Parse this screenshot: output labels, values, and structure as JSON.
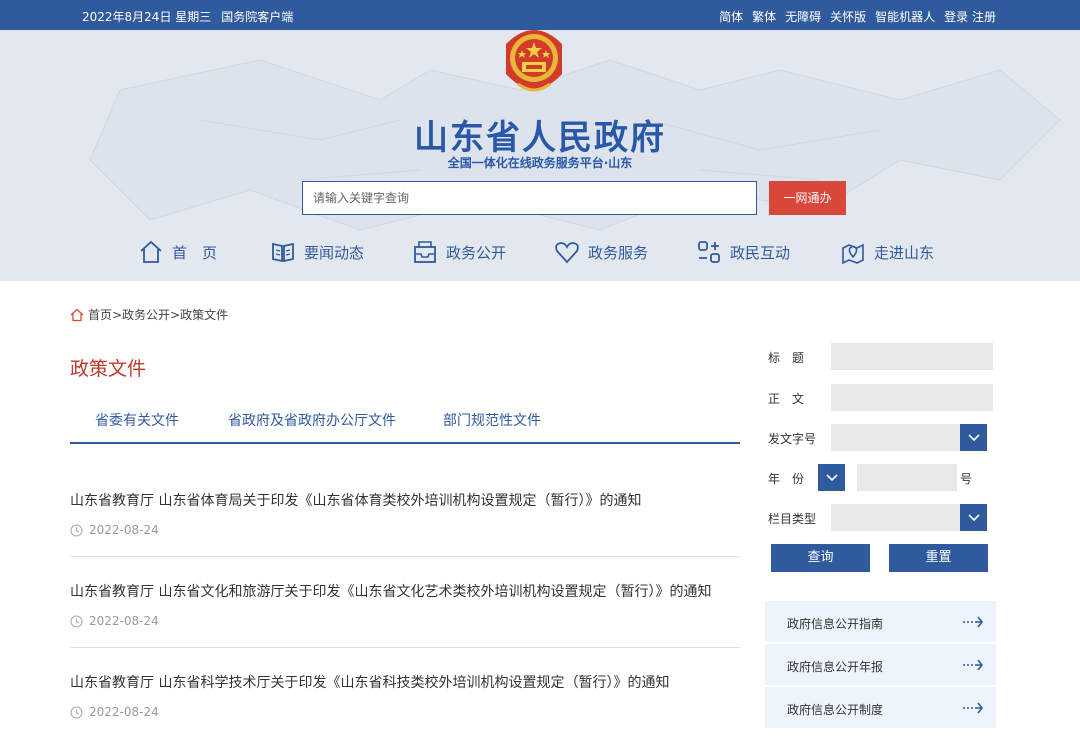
{
  "topbar": {
    "date": "2022年8月24日 星期三",
    "client": "国务院客户端",
    "links": [
      "简体",
      "繁体",
      "无障碍",
      "关怀版",
      "智能机器人",
      "登录 注册"
    ]
  },
  "header": {
    "title": "山东省人民政府",
    "subtitle": "全国一体化在线政务服务平台·山东",
    "search_placeholder": "请输入关键字查询",
    "search_button": "一网通办"
  },
  "nav": {
    "items": [
      {
        "label": "首　页",
        "icon": "home-icon"
      },
      {
        "label": "要闻动态",
        "icon": "book-icon"
      },
      {
        "label": "政务公开",
        "icon": "inbox-icon"
      },
      {
        "label": "政务服务",
        "icon": "heart-icon"
      },
      {
        "label": "政民互动",
        "icon": "interaction-icon"
      },
      {
        "label": "走进山东",
        "icon": "map-pin-icon"
      }
    ]
  },
  "breadcrumb": {
    "text": "首页>政务公开>政策文件"
  },
  "page": {
    "title": "政策文件"
  },
  "tabs": [
    "省委有关文件",
    "省政府及省政府办公厅文件",
    "部门规范性文件"
  ],
  "documents": [
    {
      "title": "山东省教育厅 山东省体育局关于印发《山东省体育类校外培训机构设置规定（暂行）》的通知",
      "date": "2022-08-24"
    },
    {
      "title": "山东省教育厅 山东省文化和旅游厅关于印发《山东省文化艺术类校外培训机构设置规定（暂行）》的通知",
      "date": "2022-08-24"
    },
    {
      "title": "山东省教育厅 山东省科学技术厅关于印发《山东省科技类校外培训机构设置规定（暂行）》的通知",
      "date": "2022-08-24"
    }
  ],
  "search_form": {
    "title_label": "标　题",
    "body_label": "正　文",
    "doc_no_label": "发文字号",
    "year_label": "年　份",
    "number_suffix": "号",
    "column_label": "栏目类型",
    "query_button": "查询",
    "reset_button": "重置"
  },
  "side_links": [
    "政府信息公开指南",
    "政府信息公开年报",
    "政府信息公开制度"
  ],
  "colors": {
    "primary": "#2f5a9e",
    "accent_red": "#d9463a",
    "title_red": "#c0392b"
  }
}
